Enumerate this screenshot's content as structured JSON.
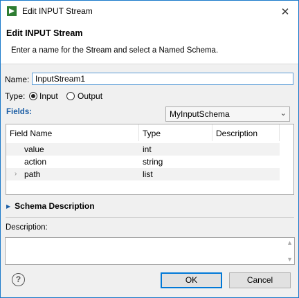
{
  "window": {
    "title": "Edit INPUT Stream",
    "close_glyph": "✕"
  },
  "banner": {
    "title": "Edit INPUT Stream",
    "message": "Enter a name for the Stream and select a Named Schema."
  },
  "name": {
    "label": "Name:",
    "value": "InputStream1"
  },
  "type": {
    "label": "Type:",
    "options": [
      {
        "label": "Input",
        "selected": true
      },
      {
        "label": "Output",
        "selected": false
      }
    ]
  },
  "fields": {
    "label": "Fields:",
    "schema_selected": "MyInputSchema",
    "columns": [
      "Field Name",
      "Type",
      "Description"
    ],
    "rows": [
      {
        "name": "value",
        "type": "int",
        "description": ""
      },
      {
        "name": "action",
        "type": "string",
        "description": ""
      },
      {
        "name": "path",
        "type": "list",
        "description": "",
        "expandable": true
      }
    ]
  },
  "schema_description": {
    "label": "Schema Description"
  },
  "description": {
    "label": "Description:",
    "value": ""
  },
  "buttons": {
    "ok": "OK",
    "cancel": "Cancel"
  },
  "icons": {
    "app": "app-icon",
    "close": "close-icon",
    "help": "help-icon",
    "dropdown": "chevron-down-icon",
    "expander": "chevron-right-icon",
    "section_toggle": "triangle-right-icon"
  },
  "colors": {
    "accent": "#0078d7",
    "link_blue": "#1c5ea5",
    "border": "#1979ca"
  }
}
